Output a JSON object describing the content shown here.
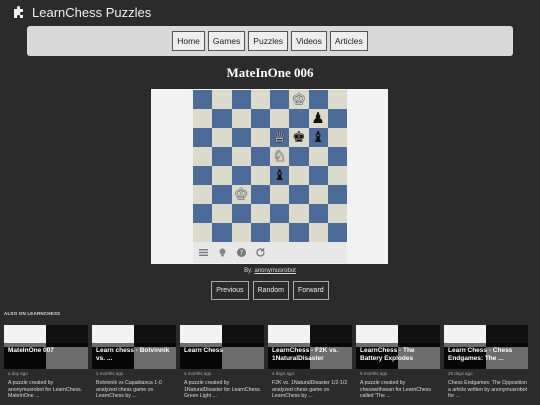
{
  "header": {
    "title": "LearnChess Puzzles",
    "logo_icon": "puzzle-piece-icon"
  },
  "nav": {
    "items": [
      "Home",
      "Games",
      "Puzzles",
      "Videos",
      "Articles"
    ]
  },
  "puzzle": {
    "title": "MateInOne 006",
    "byline_prefix": "By:",
    "author": "anonymusrobot",
    "board_colors": {
      "light": "#dcdacb",
      "dark": "#4b6c9b"
    },
    "pieces": [
      {
        "square": "f8",
        "glyph": "♔",
        "color": "white"
      },
      {
        "square": "g7",
        "glyph": "♟",
        "color": "black"
      },
      {
        "square": "e6",
        "glyph": "♕",
        "color": "white"
      },
      {
        "square": "f6",
        "glyph": "♚",
        "color": "black"
      },
      {
        "square": "g6",
        "glyph": "♝",
        "color": "black"
      },
      {
        "square": "e5",
        "glyph": "♘",
        "color": "white"
      },
      {
        "square": "e4",
        "glyph": "♝",
        "color": "black"
      },
      {
        "square": "c3",
        "glyph": "♔",
        "color": "white"
      }
    ],
    "tools": [
      "menu-icon",
      "hint-bulb-icon",
      "help-icon",
      "reset-icon"
    ]
  },
  "pager": {
    "previous": "Previous",
    "random": "Random",
    "forward": "Forward"
  },
  "also_on": {
    "label_prefix": "ALSO ON",
    "label_site": "LEARNCHESS"
  },
  "cards": [
    {
      "title": "MateInOne 007",
      "date": "a day ago",
      "desc": "A puzzle created by anonymusrobot for LearnChess. MateInOne ..."
    },
    {
      "title": "Learn chess - Botvinnik vs. ...",
      "date": "2 months ago",
      "desc": "Botvinnik vs Capablanca 1-0 analyzed chess game on LearnChess by ..."
    },
    {
      "title": "Learn Chess",
      "date": "4 months ago",
      "desc": "A puzzle created by 1NaturalDisaster for LearnChess. Green Light ..."
    },
    {
      "title": "LearnChess - F2K vs. 1NaturalDisaster",
      "date": "4 days ago",
      "desc": "F2K vs. 1NaturalDisaster 1/2-1/2 analyzed chess game on LearnChess by ..."
    },
    {
      "title": "LearnChess - The Battery Explodes",
      "date": "9 months ago",
      "desc": "A puzzle created by chesswithsean for LearnChess called 'The ..."
    },
    {
      "title": "Learn Chess - Chess Endgames: The ...",
      "date": "25 days ago",
      "desc": "Chess Endgames: The Opposition a article written by anonymusrobot for ..."
    }
  ]
}
